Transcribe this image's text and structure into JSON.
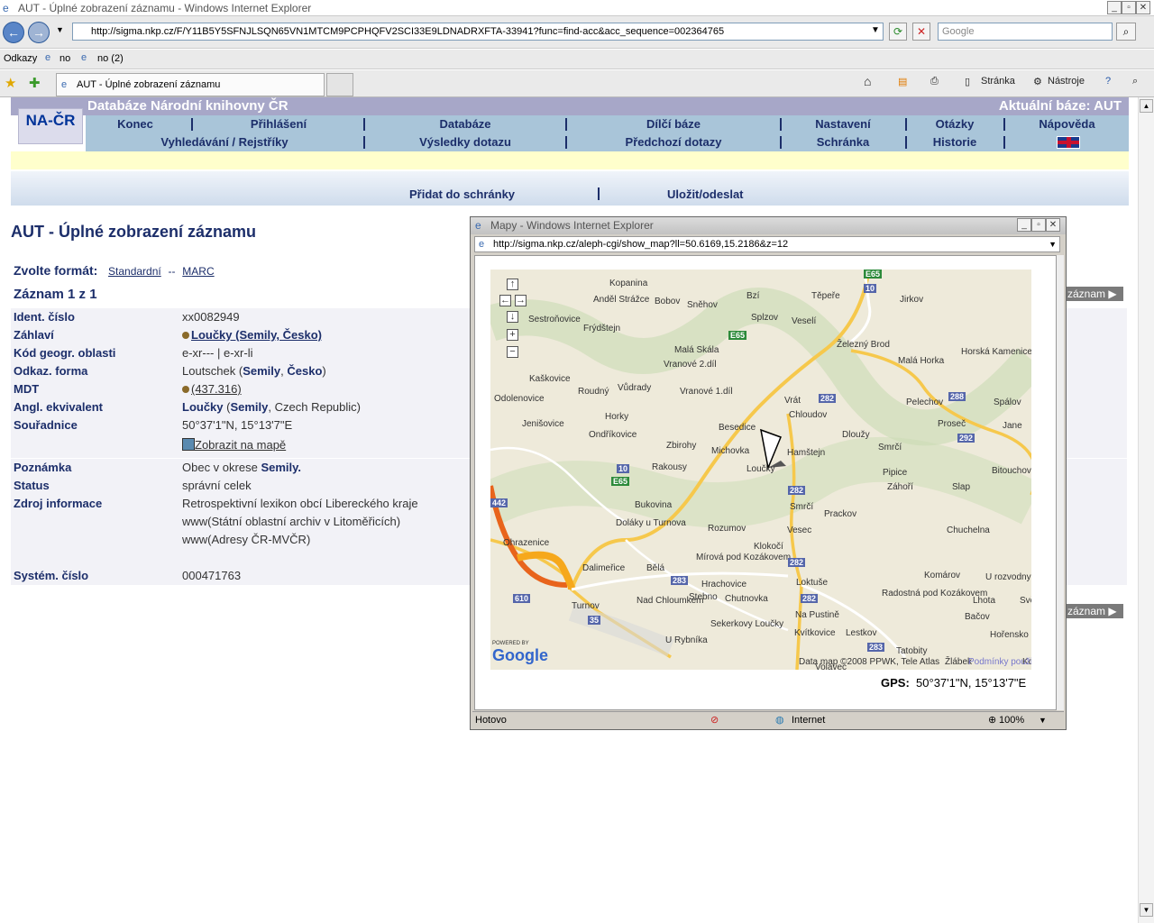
{
  "window": {
    "title": "AUT - Úplné zobrazení záznamu - Windows Internet Explorer"
  },
  "browser": {
    "address": "http://sigma.nkp.cz/F/Y11B5Y5SFNJLSQN65VN1MTCM9PCPHQFV2SCI33E9LDNADRXFTA-33941?func=find-acc&acc_sequence=002364765",
    "search_placeholder": "Google",
    "links_label": "Odkazy",
    "link1": "no",
    "link2": "no (2)",
    "tab_label": "AUT - Úplné zobrazení záznamu",
    "tb_page": "Stránka",
    "tb_tools": "Nástroje"
  },
  "header": {
    "title": "Databáze Národní knihovny ČR",
    "current_base": "Aktuální báze:  AUT",
    "logo": "NA-ČR"
  },
  "menu1": [
    "Konec",
    "Přihlášení",
    "Databáze",
    "Dílčí báze",
    "Nastavení",
    "Otázky",
    "Nápověda"
  ],
  "menu2": [
    "Vyhledávání / Rejstříky",
    "Výsledky dotazu",
    "Předchozí dotazy",
    "Schránka",
    "Historie"
  ],
  "actions": {
    "add": "Přidat do schránky",
    "save": "Uložit/odeslat"
  },
  "page": {
    "title": "AUT - Úplné zobrazení záznamu",
    "format_label": "Zvolte formát:",
    "format_standard": "Standardní",
    "format_sep": "--",
    "format_marc": "MARC",
    "record": "Záznam 1 z 1",
    "next_label": "záznam"
  },
  "fields": {
    "ident_k": "Ident. číslo",
    "ident_v": "xx0082949",
    "zahlavi_k": "Záhlaví",
    "zahlavi_v": "Loučky (Semily, Česko)",
    "kod_k": "Kód geogr. oblasti",
    "kod_v": "e-xr--- | e-xr-li",
    "odkaz_k": "Odkaz. forma",
    "odkaz_v1": "Loutschek (",
    "odkaz_v2": "Semily",
    ", ": ", ",
    "odkaz_v3": "Česko",
    "odkaz_v4": ")",
    "mdt_k": "MDT",
    "mdt_v": "(437.316)",
    "angl_k": "Angl. ekvivalent",
    "angl_v1": "Loučky",
    "angl_v2": "Semily",
    "angl_v3": "Czech Republic",
    "sour_k": "Souřadnice",
    "sour_v": "50°37'1\"N, 15°13'7\"E",
    "map_link": "Zobrazit na mapě",
    "pozn_k": "Poznámka",
    "pozn_v1": "Obec v okrese",
    "pozn_v2": "Semily.",
    "status_k": "Status",
    "status_v": "správní celek",
    "zdroj_k": "Zdroj informace",
    "zdroj_v1": "Retrospektivní lexikon obcí Libereckého kraje",
    "zdroj_v2": "www(Státní oblastní archiv v Litoměřicích)",
    "zdroj_v3": "www(Adresy ČR-MVČR)",
    "sys_k": "Systém. číslo",
    "sys_v": "000471763"
  },
  "popup": {
    "title": "Mapy - Windows Internet Explorer",
    "address": "http://sigma.nkp.cz/aleph-cgi/show_map?ll=50.6169,15.2186&z=12",
    "gps_label": "GPS:",
    "gps_value": "50°37'1\"N, 15°13'7\"E",
    "status": "Hotovo",
    "zone": "Internet",
    "zoom": "100%",
    "map_copyright": "Data map ©2008 PPWK, Tele Atlas",
    "map_terms": "Podmínky použití",
    "powered": "POWERED BY",
    "google": "Google"
  },
  "map_labels": [
    "Kopanina",
    "Anděl Strážce",
    "Bobov",
    "Sněhov",
    "Bzí",
    "Těpeře",
    "Jirkov",
    "Sestroňovice",
    "Frýdštejn",
    "Splzov",
    "Veselí",
    "Malá Skála",
    "Železný Brod",
    "Horská Kamenice",
    "Malá Horka",
    "Vranové 2.díl",
    "Kaškovice",
    "Roudný",
    "Vůdrady",
    "Vranové 1.díl",
    "Vrát",
    "Pelechov",
    "Spálov",
    "Odolenovice",
    "Jenišovice",
    "Horky",
    "Chloudov",
    "Proseč",
    "Ondříkovice",
    "Besedice",
    "Dloužy",
    "Jane",
    "Zbirohy",
    "Michovka",
    "Hamštejn",
    "Smrčí",
    "Rakousy",
    "Loučky",
    "Pipice",
    "Bitouchov",
    "Záhoří",
    "Slap",
    "Bukovina",
    "Smrčí",
    "Prackov",
    "Doláky u Turnova",
    "Rozumov",
    "Vesec",
    "Chuchelna",
    "Ohrazenice",
    "Klokočí",
    "Dalimeřice",
    "Bělá",
    "Mírová pod Kozákovem",
    "Komárov",
    "Hrachovice",
    "Loktuše",
    "U rozvodny",
    "Nad Chloumkem",
    "Stebno",
    "Chutnovka",
    "Radostná pod Kozákovem",
    "Lhota",
    "Světlá",
    "Turnov",
    "Na Pustině",
    "Bačov",
    "Sekerkovy Loučky",
    "Kvítkovice",
    "Lestkov",
    "U Rybníka",
    "Hořensko",
    "Tatobity",
    "Volavec",
    "Žlábek",
    "Koldšice"
  ],
  "road_numbers": [
    "E65",
    "10",
    "E65",
    "282",
    "288",
    "292",
    "10",
    "E65",
    "282",
    "282",
    "283",
    "282",
    "35",
    "610",
    "283",
    "442"
  ],
  "colors": {
    "header": "#a7a7c8",
    "menu": "#a9c5d9",
    "text": "#1c2e6a",
    "yellow": "#ffffcc"
  }
}
